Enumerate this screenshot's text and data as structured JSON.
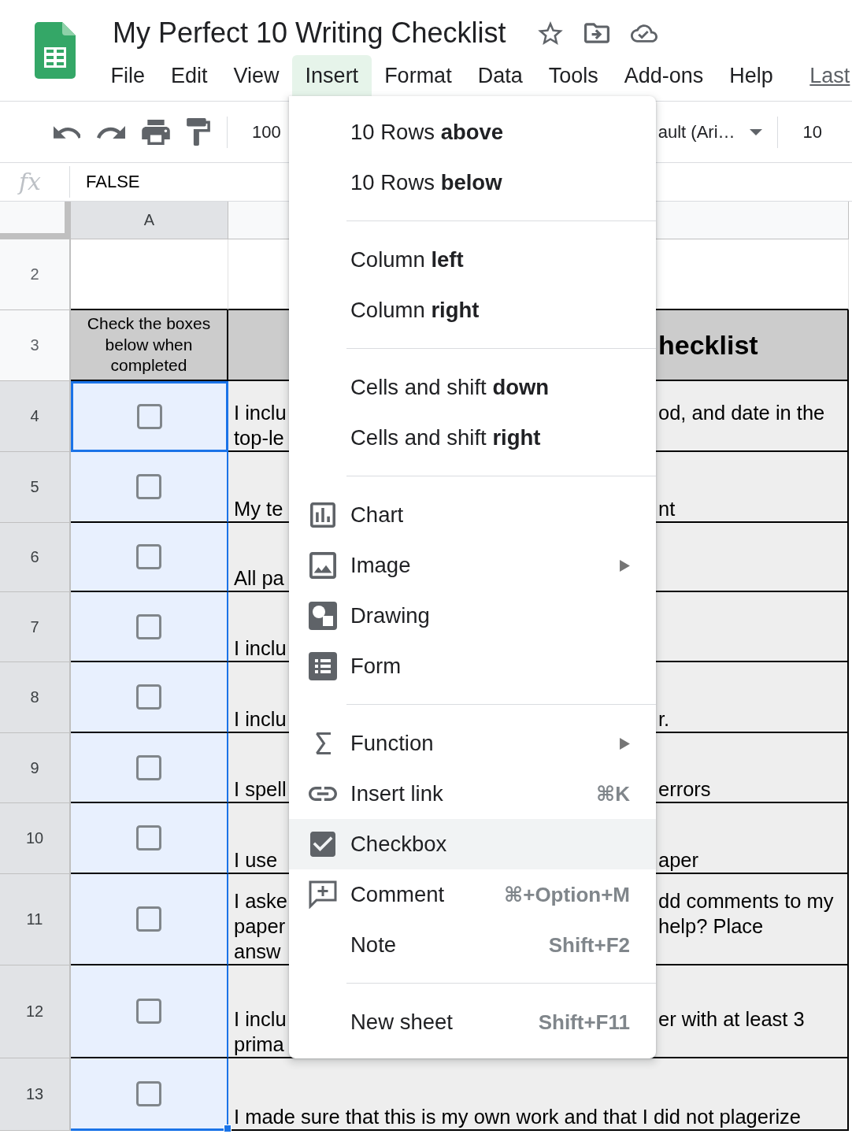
{
  "header": {
    "title": "My Perfect 10 Writing Checklist",
    "menus": [
      {
        "label": "File",
        "selected": false
      },
      {
        "label": "Edit",
        "selected": false
      },
      {
        "label": "View",
        "selected": false
      },
      {
        "label": "Insert",
        "selected": true
      },
      {
        "label": "Format",
        "selected": false
      },
      {
        "label": "Data",
        "selected": false
      },
      {
        "label": "Tools",
        "selected": false
      },
      {
        "label": "Add-ons",
        "selected": false
      },
      {
        "label": "Help",
        "selected": false
      }
    ],
    "last_edit": "Last"
  },
  "toolbar": {
    "zoom": "100",
    "font": "ault (Ari…",
    "font_size": "10"
  },
  "formula_bar": {
    "label": "fx",
    "value": "FALSE"
  },
  "grid": {
    "columns": [
      {
        "label": "A",
        "selected": true
      }
    ],
    "rows": [
      {
        "number": "2",
        "selected": false,
        "kind": "blank"
      },
      {
        "number": "3",
        "selected": false,
        "kind": "heading",
        "label": "Check the boxes below when completed",
        "b_right": [
          "hecklist"
        ]
      },
      {
        "number": "4",
        "selected": true,
        "kind": "task",
        "checked": false,
        "active": true,
        "b_left": [
          "I inclu",
          "top-le"
        ],
        "b_right": [
          "od, and date in the"
        ]
      },
      {
        "number": "5",
        "selected": true,
        "kind": "task",
        "checked": false,
        "active": false,
        "b_left": [
          "My te"
        ],
        "b_right": [
          "nt"
        ]
      },
      {
        "number": "6",
        "selected": true,
        "kind": "task",
        "checked": false,
        "active": false,
        "b_left": [
          "All pa"
        ]
      },
      {
        "number": "7",
        "selected": true,
        "kind": "task",
        "checked": false,
        "active": false,
        "b_left": [
          "I inclu"
        ]
      },
      {
        "number": "8",
        "selected": true,
        "kind": "task",
        "checked": false,
        "active": false,
        "b_left": [
          "I inclu"
        ],
        "b_right": [
          "r."
        ]
      },
      {
        "number": "9",
        "selected": true,
        "kind": "task",
        "checked": false,
        "active": false,
        "b_left": [
          "I spell"
        ],
        "b_right": [
          "errors"
        ]
      },
      {
        "number": "10",
        "selected": true,
        "kind": "task",
        "checked": false,
        "active": false,
        "b_left": [
          "I use"
        ],
        "b_right": [
          "aper"
        ]
      },
      {
        "number": "11",
        "selected": true,
        "kind": "task",
        "checked": false,
        "active": false,
        "b_left": [
          "I aske",
          "paper",
          "answ"
        ],
        "b_right": [
          "dd comments to my",
          "help? Place"
        ]
      },
      {
        "number": "12",
        "selected": true,
        "kind": "task",
        "checked": false,
        "active": false,
        "b_left": [
          "I inclu",
          "prima"
        ],
        "b_right": [
          "er with at least 3"
        ]
      },
      {
        "number": "13",
        "selected": true,
        "kind": "task",
        "checked": false,
        "active": false,
        "b_full": [
          "I made sure that this is my own work and that I did not plagerize"
        ]
      }
    ]
  },
  "insert_menu": {
    "sections": [
      {
        "items": [
          {
            "label": "10 Rows **above**",
            "kind": "text",
            "submenu": false,
            "highlighted": false
          },
          {
            "label": "10 Rows **below**",
            "kind": "text",
            "submenu": false,
            "highlighted": false
          }
        ]
      },
      {
        "items": [
          {
            "label": "Column **left**",
            "kind": "text",
            "submenu": false,
            "highlighted": false
          },
          {
            "label": "Column **right**",
            "kind": "text",
            "submenu": false,
            "highlighted": false
          }
        ]
      },
      {
        "items": [
          {
            "label": "Cells and shift **down**",
            "kind": "text",
            "submenu": false,
            "highlighted": false
          },
          {
            "label": "Cells and shift **right**",
            "kind": "text",
            "submenu": false,
            "highlighted": false
          }
        ]
      },
      {
        "items": [
          {
            "label": "Chart",
            "kind": "chart",
            "submenu": false,
            "highlighted": false
          },
          {
            "label": "Image",
            "kind": "image",
            "submenu": true,
            "highlighted": false
          },
          {
            "label": "Drawing",
            "kind": "drawing",
            "submenu": false,
            "highlighted": false
          },
          {
            "label": "Form",
            "kind": "form",
            "submenu": false,
            "highlighted": false
          }
        ]
      },
      {
        "items": [
          {
            "label": "Function",
            "kind": "function",
            "submenu": true,
            "highlighted": false
          },
          {
            "label": "Insert link",
            "kind": "link",
            "shortcut": "⌘K",
            "submenu": false,
            "highlighted": false
          },
          {
            "label": "Checkbox",
            "kind": "checkbox",
            "submenu": false,
            "highlighted": true
          },
          {
            "label": "Comment",
            "kind": "comment",
            "shortcut": "⌘+Option+M",
            "submenu": false,
            "highlighted": false
          },
          {
            "label": "Note",
            "kind": "text",
            "shortcut": "Shift+F2",
            "submenu": false,
            "highlighted": false
          }
        ]
      },
      {
        "items": [
          {
            "label": "New sheet",
            "kind": "text",
            "shortcut": "Shift+F11",
            "submenu": false,
            "highlighted": false
          }
        ]
      }
    ]
  }
}
